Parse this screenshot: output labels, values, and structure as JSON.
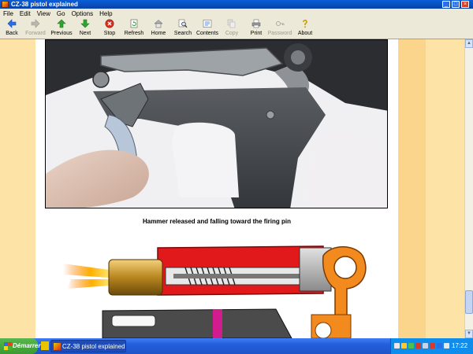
{
  "window": {
    "title": "CZ-38 pistol explained"
  },
  "menu": [
    "File",
    "Edit",
    "View",
    "Go",
    "Options",
    "Help"
  ],
  "toolbar": [
    {
      "label": "Back",
      "icon": "back-arrow-icon",
      "enabled": true
    },
    {
      "label": "Forward",
      "icon": "forward-arrow-icon",
      "enabled": false
    },
    {
      "label": "Previous",
      "icon": "up-arrow-icon",
      "enabled": true
    },
    {
      "label": "Next",
      "icon": "down-arrow-icon",
      "enabled": true
    },
    {
      "label": "Stop",
      "icon": "stop-icon",
      "enabled": true
    },
    {
      "label": "Refresh",
      "icon": "refresh-icon",
      "enabled": true
    },
    {
      "label": "Home",
      "icon": "home-icon",
      "enabled": true
    },
    {
      "label": "Search",
      "icon": "search-icon",
      "enabled": true
    },
    {
      "label": "Contents",
      "icon": "contents-icon",
      "enabled": true
    },
    {
      "label": "Copy",
      "icon": "copy-icon",
      "enabled": false
    },
    {
      "label": "Print",
      "icon": "print-icon",
      "enabled": true
    },
    {
      "label": "Password",
      "icon": "password-icon",
      "enabled": false
    },
    {
      "label": "About",
      "icon": "about-icon",
      "enabled": true
    }
  ],
  "content": {
    "caption": "Hammer released and falling toward the firing pin",
    "colors": {
      "side": "#fde3a5",
      "side_inner": "#fbd58c"
    }
  },
  "taskbar": {
    "start_label": "Démarrer",
    "task_title": "CZ-38 pistol explained",
    "clock": "17:22"
  }
}
